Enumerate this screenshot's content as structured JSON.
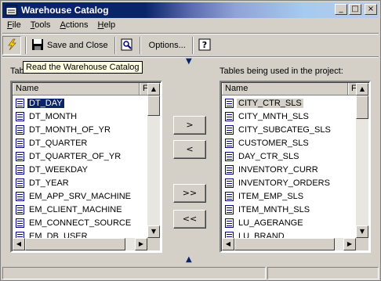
{
  "window": {
    "title": "Warehouse Catalog"
  },
  "title_buttons": {
    "minimize": "_",
    "maximize": "□",
    "close": "×"
  },
  "menu": [
    {
      "label": "File",
      "mnemonic": "F",
      "rest": "ile"
    },
    {
      "label": "Tools",
      "mnemonic": "T",
      "rest": "ools"
    },
    {
      "label": "Actions",
      "mnemonic": "A",
      "rest": "ctions"
    },
    {
      "label": "Help",
      "mnemonic": "H",
      "rest": "elp"
    }
  ],
  "toolbar": {
    "read_icon": "lightning-icon",
    "save_close_label": "Save and Close",
    "preview_icon": "table-preview-icon",
    "options_label": "Options...",
    "help_icon": "help-question-icon"
  },
  "tooltip": "Read the Warehouse Catalog",
  "left_panel": {
    "label": "Tables available in the warehouse:",
    "visible_label": "Tab",
    "columns": [
      "Name",
      "F"
    ],
    "rows": [
      "DT_DAY",
      "DT_MONTH",
      "DT_MONTH_OF_YR",
      "DT_QUARTER",
      "DT_QUARTER_OF_YR",
      "DT_WEEKDAY",
      "DT_YEAR",
      "EM_APP_SRV_MACHINE",
      "EM_CLIENT_MACHINE",
      "EM_CONNECT_SOURCE",
      "EM_DB_USER"
    ],
    "selected": "DT_DAY"
  },
  "right_panel": {
    "label": "Tables being used in the project:",
    "columns": [
      "Name",
      "F"
    ],
    "rows": [
      "CITY_CTR_SLS",
      "CITY_MNTH_SLS",
      "CITY_SUBCATEG_SLS",
      "CUSTOMER_SLS",
      "DAY_CTR_SLS",
      "INVENTORY_CURR",
      "INVENTORY_ORDERS",
      "ITEM_EMP_SLS",
      "ITEM_MNTH_SLS",
      "LU_AGERANGE",
      "LU_BRAND"
    ],
    "selected": "CITY_CTR_SLS"
  },
  "move_buttons": {
    "add": ">",
    "remove": "<",
    "add_all": ">>",
    "remove_all": "<<"
  },
  "indicators": {
    "up": "▼",
    "down": "▲"
  }
}
